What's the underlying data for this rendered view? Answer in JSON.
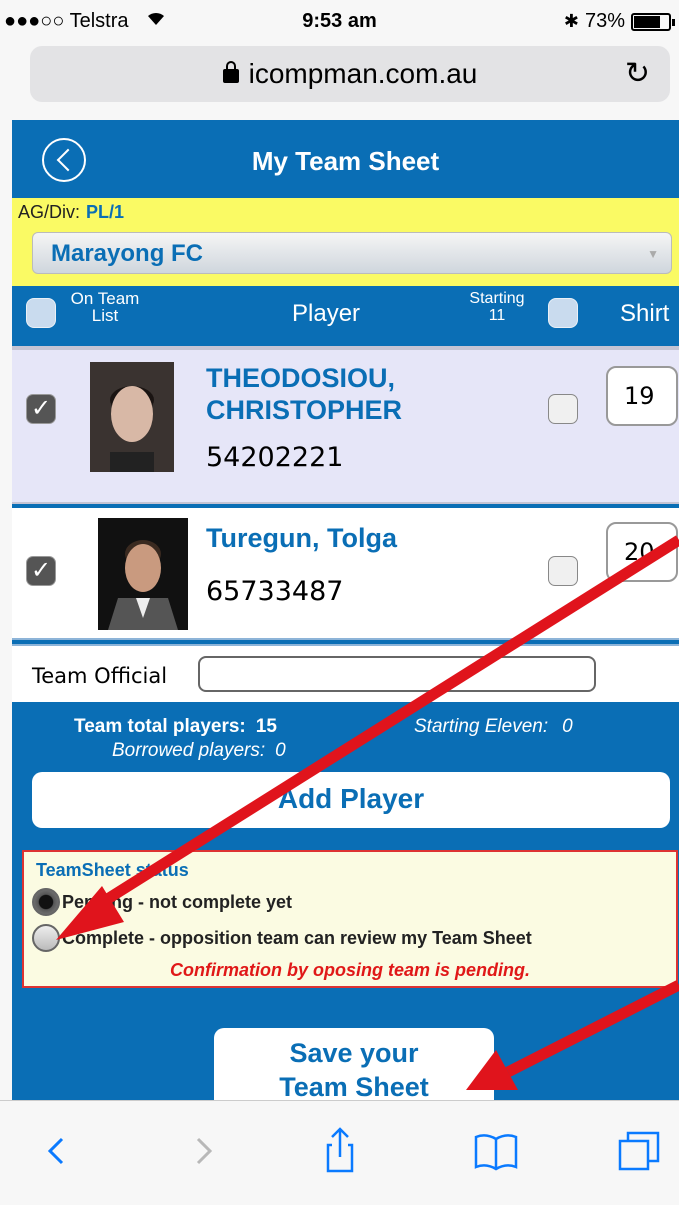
{
  "status_bar": {
    "carrier": "●●●○○ Telstra",
    "time": "9:53 am",
    "battery": "73%"
  },
  "browser": {
    "url": "icompman.com.au"
  },
  "header": {
    "title": "My Team Sheet"
  },
  "filter": {
    "agdiv_label": "AG/Div:",
    "agdiv_value": "PL/1",
    "team": "Marayong FC"
  },
  "columns": {
    "on_team": "On Team List",
    "player": "Player",
    "starting": "Starting 11",
    "shirt": "Shirt"
  },
  "players": [
    {
      "name_line1": "THEODOSIOU,",
      "name_line2": "CHRISTOPHER",
      "number": "54202221",
      "shirt": "19",
      "on_team": true,
      "starting": false
    },
    {
      "name_line1": "Turegun, Tolga",
      "name_line2": "",
      "number": "65733487",
      "shirt": "20",
      "on_team": true,
      "starting": false
    }
  ],
  "team_official": {
    "label": "Team Official",
    "value": ""
  },
  "totals": {
    "team_total_label": "Team total players:",
    "team_total_value": "15",
    "starting_label": "Starting Eleven:",
    "starting_value": "0",
    "borrowed_label": "Borrowed players:",
    "borrowed_value": "0"
  },
  "add_player_label": "Add Player",
  "teamsheet_status": {
    "heading": "TeamSheet status",
    "options": [
      {
        "label": "Pending - not complete yet",
        "selected": true
      },
      {
        "label": "Complete - opposition team can review my Team Sheet",
        "selected": false
      }
    ],
    "confirmation": "Confirmation by oposing team is pending."
  },
  "save_button": {
    "line1": "Save your",
    "line2": "Team Sheet"
  },
  "colors": {
    "brand_blue": "#0a6eb5",
    "highlight_yellow": "#fafa64",
    "annotation_red": "#e0141c"
  }
}
